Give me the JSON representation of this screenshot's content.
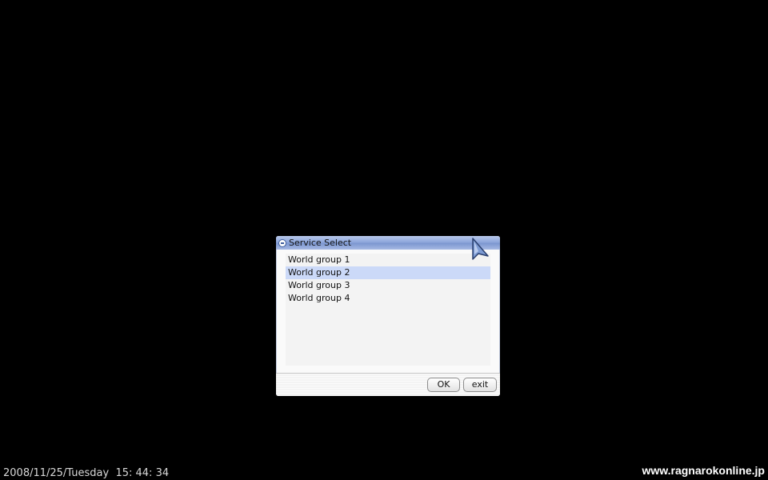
{
  "dialog": {
    "title": "Service Select",
    "items": [
      {
        "label": "World group 1"
      },
      {
        "label": "World group 2"
      },
      {
        "label": "World group 3"
      },
      {
        "label": "World group 4"
      }
    ],
    "selected_index": 1,
    "ok_label": "OK",
    "exit_label": "exit"
  },
  "overlay": {
    "timestamp": "2008/11/25/Tuesday  15: 44: 34",
    "site_url": "www.ragnarokonline.jp"
  },
  "colors": {
    "background": "#000000",
    "selection": "#cbd9f8",
    "title_bar": "#8ea7dc"
  }
}
